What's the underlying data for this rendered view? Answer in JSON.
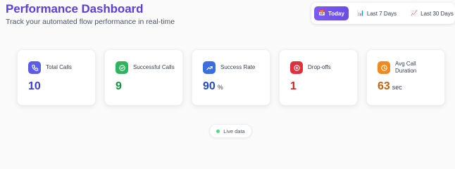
{
  "header": {
    "title": "Performance Dashboard",
    "subtitle": "Track your automated flow performance in real-time"
  },
  "ranges": [
    {
      "label": "Today",
      "icon": "calendar-icon",
      "active": true
    },
    {
      "label": "Last 7 Days",
      "icon": "bar-chart-icon",
      "active": false
    },
    {
      "label": "Last 30 Days",
      "icon": "line-chart-icon",
      "active": false
    }
  ],
  "cards": [
    {
      "label": "Total Calls",
      "value": "10",
      "unit": "",
      "icon": "phone-icon",
      "color": "#3b3fd6",
      "badge": "#5b5ce8"
    },
    {
      "label": "Successful Calls",
      "value": "9",
      "unit": "",
      "icon": "check-circle-icon",
      "color": "#15913f",
      "badge": "#2fb35c"
    },
    {
      "label": "Success Rate",
      "value": "90",
      "unit": "%",
      "icon": "trending-up-icon",
      "color": "#2049c7",
      "badge": "#3b6fe0"
    },
    {
      "label": "Drop-offs",
      "value": "1",
      "unit": "",
      "icon": "x-circle-icon",
      "color": "#d3262b",
      "badge": "#e0303b"
    },
    {
      "label": "Avg Call Duration",
      "value": "63",
      "unit": "sec",
      "icon": "clock-icon",
      "color": "#c26412",
      "badge": "#f08a1d"
    }
  ],
  "status": {
    "label": "Live data",
    "color": "#4ade80"
  }
}
